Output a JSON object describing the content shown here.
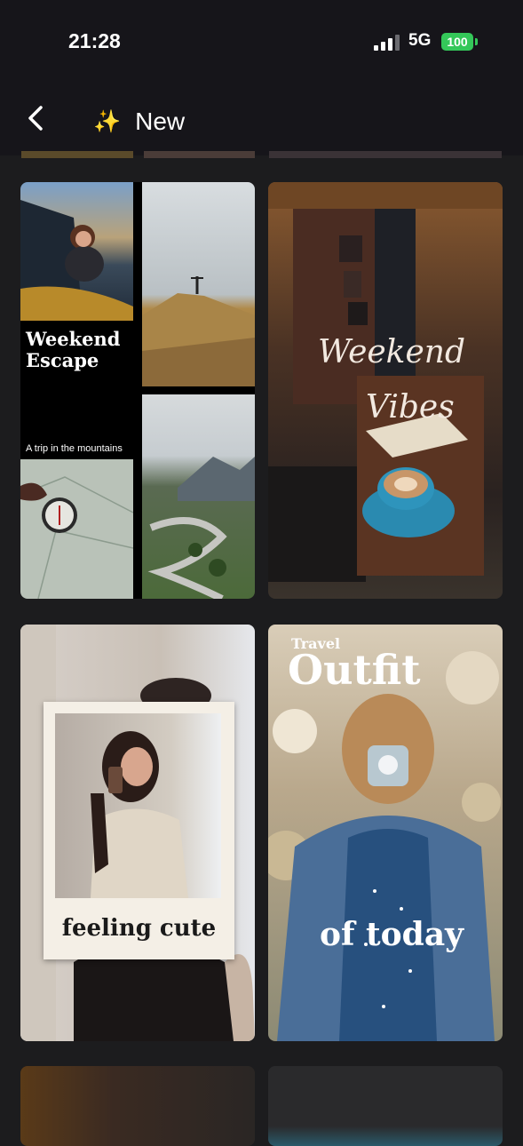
{
  "status_bar": {
    "time": "21:28",
    "network": "5G",
    "battery": "100"
  },
  "header": {
    "title": "New",
    "back_icon": "chevron-left-icon",
    "sparkle_icon": "sparkles-icon"
  },
  "templates": [
    {
      "title_line1": "Weekend",
      "title_line2": "Escape",
      "subtitle": "A trip in the mountains"
    },
    {
      "title_line1": "Weekend",
      "title_line2": "Vibes"
    },
    {
      "caption": "feeling cute"
    },
    {
      "kicker": "Travel",
      "title": "Outfit",
      "footer": "of today"
    }
  ],
  "colors": {
    "background": "#1c1c1e",
    "header": "#16151a",
    "battery": "#34c759"
  }
}
